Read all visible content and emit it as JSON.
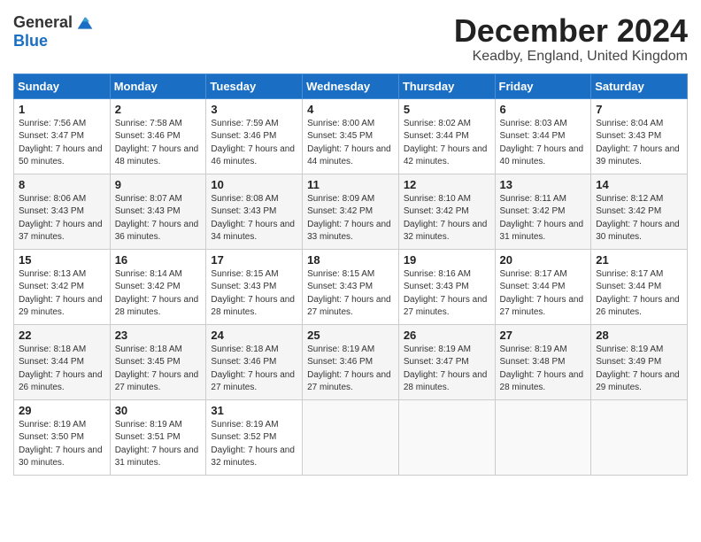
{
  "header": {
    "logo_general": "General",
    "logo_blue": "Blue",
    "title": "December 2024",
    "location": "Keadby, England, United Kingdom"
  },
  "days_of_week": [
    "Sunday",
    "Monday",
    "Tuesday",
    "Wednesday",
    "Thursday",
    "Friday",
    "Saturday"
  ],
  "weeks": [
    [
      {
        "day": "1",
        "sunrise": "Sunrise: 7:56 AM",
        "sunset": "Sunset: 3:47 PM",
        "daylight": "Daylight: 7 hours and 50 minutes."
      },
      {
        "day": "2",
        "sunrise": "Sunrise: 7:58 AM",
        "sunset": "Sunset: 3:46 PM",
        "daylight": "Daylight: 7 hours and 48 minutes."
      },
      {
        "day": "3",
        "sunrise": "Sunrise: 7:59 AM",
        "sunset": "Sunset: 3:46 PM",
        "daylight": "Daylight: 7 hours and 46 minutes."
      },
      {
        "day": "4",
        "sunrise": "Sunrise: 8:00 AM",
        "sunset": "Sunset: 3:45 PM",
        "daylight": "Daylight: 7 hours and 44 minutes."
      },
      {
        "day": "5",
        "sunrise": "Sunrise: 8:02 AM",
        "sunset": "Sunset: 3:44 PM",
        "daylight": "Daylight: 7 hours and 42 minutes."
      },
      {
        "day": "6",
        "sunrise": "Sunrise: 8:03 AM",
        "sunset": "Sunset: 3:44 PM",
        "daylight": "Daylight: 7 hours and 40 minutes."
      },
      {
        "day": "7",
        "sunrise": "Sunrise: 8:04 AM",
        "sunset": "Sunset: 3:43 PM",
        "daylight": "Daylight: 7 hours and 39 minutes."
      }
    ],
    [
      {
        "day": "8",
        "sunrise": "Sunrise: 8:06 AM",
        "sunset": "Sunset: 3:43 PM",
        "daylight": "Daylight: 7 hours and 37 minutes."
      },
      {
        "day": "9",
        "sunrise": "Sunrise: 8:07 AM",
        "sunset": "Sunset: 3:43 PM",
        "daylight": "Daylight: 7 hours and 36 minutes."
      },
      {
        "day": "10",
        "sunrise": "Sunrise: 8:08 AM",
        "sunset": "Sunset: 3:43 PM",
        "daylight": "Daylight: 7 hours and 34 minutes."
      },
      {
        "day": "11",
        "sunrise": "Sunrise: 8:09 AM",
        "sunset": "Sunset: 3:42 PM",
        "daylight": "Daylight: 7 hours and 33 minutes."
      },
      {
        "day": "12",
        "sunrise": "Sunrise: 8:10 AM",
        "sunset": "Sunset: 3:42 PM",
        "daylight": "Daylight: 7 hours and 32 minutes."
      },
      {
        "day": "13",
        "sunrise": "Sunrise: 8:11 AM",
        "sunset": "Sunset: 3:42 PM",
        "daylight": "Daylight: 7 hours and 31 minutes."
      },
      {
        "day": "14",
        "sunrise": "Sunrise: 8:12 AM",
        "sunset": "Sunset: 3:42 PM",
        "daylight": "Daylight: 7 hours and 30 minutes."
      }
    ],
    [
      {
        "day": "15",
        "sunrise": "Sunrise: 8:13 AM",
        "sunset": "Sunset: 3:42 PM",
        "daylight": "Daylight: 7 hours and 29 minutes."
      },
      {
        "day": "16",
        "sunrise": "Sunrise: 8:14 AM",
        "sunset": "Sunset: 3:42 PM",
        "daylight": "Daylight: 7 hours and 28 minutes."
      },
      {
        "day": "17",
        "sunrise": "Sunrise: 8:15 AM",
        "sunset": "Sunset: 3:43 PM",
        "daylight": "Daylight: 7 hours and 28 minutes."
      },
      {
        "day": "18",
        "sunrise": "Sunrise: 8:15 AM",
        "sunset": "Sunset: 3:43 PM",
        "daylight": "Daylight: 7 hours and 27 minutes."
      },
      {
        "day": "19",
        "sunrise": "Sunrise: 8:16 AM",
        "sunset": "Sunset: 3:43 PM",
        "daylight": "Daylight: 7 hours and 27 minutes."
      },
      {
        "day": "20",
        "sunrise": "Sunrise: 8:17 AM",
        "sunset": "Sunset: 3:44 PM",
        "daylight": "Daylight: 7 hours and 27 minutes."
      },
      {
        "day": "21",
        "sunrise": "Sunrise: 8:17 AM",
        "sunset": "Sunset: 3:44 PM",
        "daylight": "Daylight: 7 hours and 26 minutes."
      }
    ],
    [
      {
        "day": "22",
        "sunrise": "Sunrise: 8:18 AM",
        "sunset": "Sunset: 3:44 PM",
        "daylight": "Daylight: 7 hours and 26 minutes."
      },
      {
        "day": "23",
        "sunrise": "Sunrise: 8:18 AM",
        "sunset": "Sunset: 3:45 PM",
        "daylight": "Daylight: 7 hours and 27 minutes."
      },
      {
        "day": "24",
        "sunrise": "Sunrise: 8:18 AM",
        "sunset": "Sunset: 3:46 PM",
        "daylight": "Daylight: 7 hours and 27 minutes."
      },
      {
        "day": "25",
        "sunrise": "Sunrise: 8:19 AM",
        "sunset": "Sunset: 3:46 PM",
        "daylight": "Daylight: 7 hours and 27 minutes."
      },
      {
        "day": "26",
        "sunrise": "Sunrise: 8:19 AM",
        "sunset": "Sunset: 3:47 PM",
        "daylight": "Daylight: 7 hours and 28 minutes."
      },
      {
        "day": "27",
        "sunrise": "Sunrise: 8:19 AM",
        "sunset": "Sunset: 3:48 PM",
        "daylight": "Daylight: 7 hours and 28 minutes."
      },
      {
        "day": "28",
        "sunrise": "Sunrise: 8:19 AM",
        "sunset": "Sunset: 3:49 PM",
        "daylight": "Daylight: 7 hours and 29 minutes."
      }
    ],
    [
      {
        "day": "29",
        "sunrise": "Sunrise: 8:19 AM",
        "sunset": "Sunset: 3:50 PM",
        "daylight": "Daylight: 7 hours and 30 minutes."
      },
      {
        "day": "30",
        "sunrise": "Sunrise: 8:19 AM",
        "sunset": "Sunset: 3:51 PM",
        "daylight": "Daylight: 7 hours and 31 minutes."
      },
      {
        "day": "31",
        "sunrise": "Sunrise: 8:19 AM",
        "sunset": "Sunset: 3:52 PM",
        "daylight": "Daylight: 7 hours and 32 minutes."
      },
      null,
      null,
      null,
      null
    ]
  ]
}
